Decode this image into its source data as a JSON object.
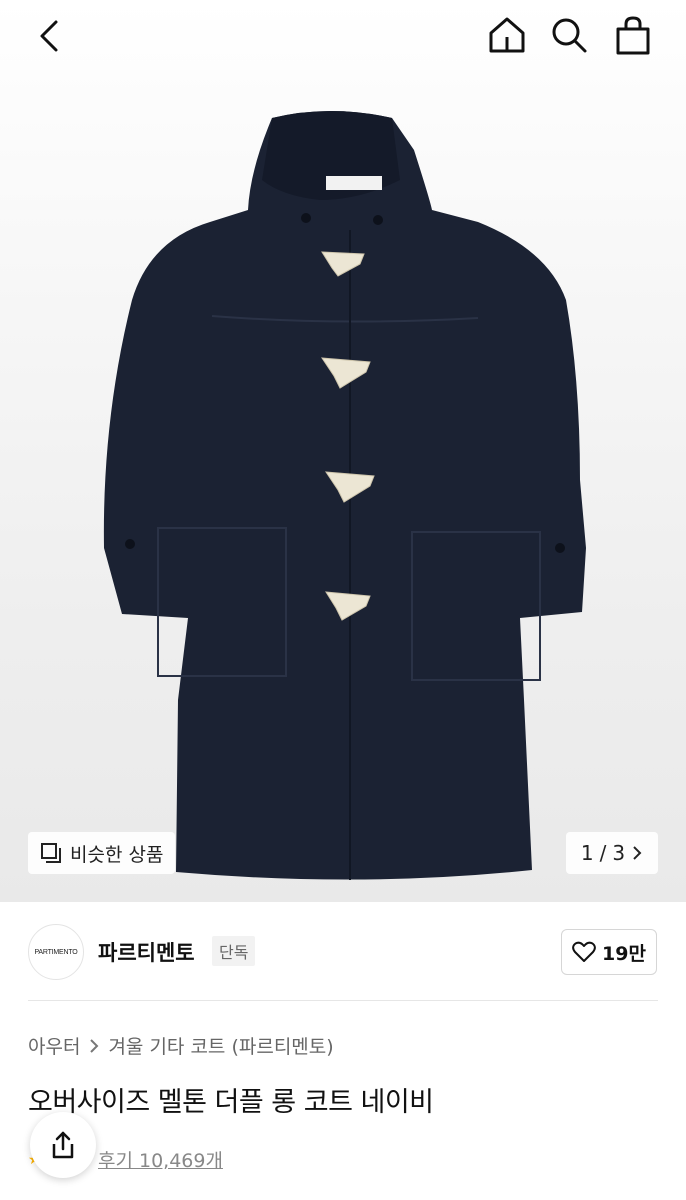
{
  "header": {
    "back_icon": "chevron-left-icon",
    "home_icon": "home-icon",
    "search_icon": "search-icon",
    "bag_icon": "shopping-bag-icon"
  },
  "gallery": {
    "image_subject": "navy duffle coat",
    "similar_label": "비슷한 상품",
    "page_current": "1",
    "page_sep": "/",
    "page_total": "3"
  },
  "brand": {
    "logo_text": "PARTIMENTO",
    "name": "파르티멘토",
    "badge": "단독",
    "like_count": "19만"
  },
  "product": {
    "breadcrumb": [
      "아우터",
      "겨울 기타 코트 (파르티멘토)"
    ],
    "title": "오버사이즈 멜톤 더플 롱 코트 네이비",
    "review_label": "후기 10,469개"
  },
  "colors": {
    "coat": "#1b2233",
    "toggle": "#ece6d4",
    "star": "#ffb400"
  }
}
